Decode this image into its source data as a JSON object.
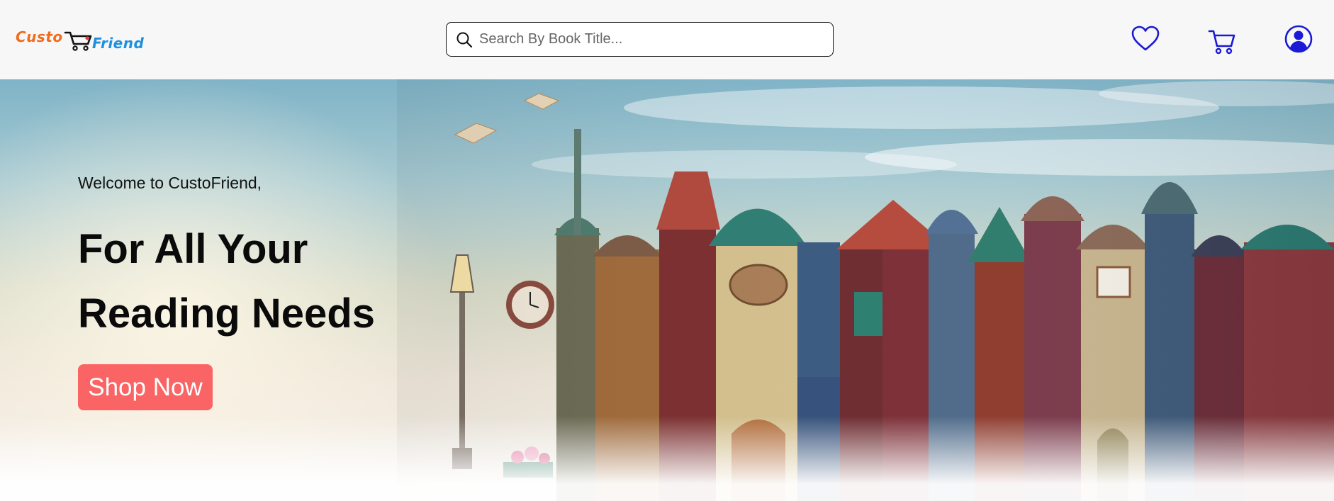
{
  "brand": {
    "name_part1": "Custo",
    "name_part2": "Friend",
    "color_primary": "#f26b1d",
    "color_secondary": "#1f8fe0",
    "icon": "shopping-cart-icon"
  },
  "search": {
    "placeholder": "Search By Book Title...",
    "value": "",
    "icon": "search-icon"
  },
  "nav": {
    "icons": [
      "heart-icon",
      "cart-icon",
      "user-icon"
    ],
    "icon_color": "#1a1ad6"
  },
  "hero": {
    "welcome": "Welcome to CustoFriend,",
    "headline_line1": "For All Your",
    "headline_line2": "Reading Needs",
    "cta_label": "Shop Now",
    "cta_color": "#fb6464"
  }
}
